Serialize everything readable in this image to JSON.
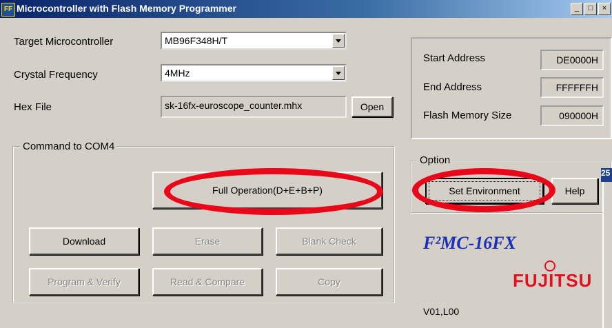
{
  "window": {
    "title": "Microcontroller with Flash Memory Programmer",
    "controls": [
      "_",
      "□",
      "×"
    ]
  },
  "target_mc": {
    "label": "Target Microcontroller",
    "value": "MB96F348H/T"
  },
  "crystal": {
    "label": "Crystal Frequency",
    "value": "4MHz"
  },
  "hexfile": {
    "label": "Hex File",
    "value": "sk-16fx-euroscope_counter.mhx",
    "open_label": "Open"
  },
  "info": {
    "start_label": "Start Address",
    "start_value": "DE0000H",
    "end_label": "End Address",
    "end_value": "FFFFFFH",
    "size_label": "Flash Memory Size",
    "size_value": "090000H"
  },
  "command": {
    "legend": "Command to COM4",
    "full_op": "Full Operation(D+E+B+P)",
    "download": "Download",
    "erase": "Erase",
    "blank": "Blank Check",
    "program": "Program & Verify",
    "read": "Read & Compare",
    "copy": "Copy"
  },
  "option": {
    "legend": "Option",
    "set_env": "Set Environment",
    "help": "Help"
  },
  "brand": {
    "f2mc": "F²MC-16FX",
    "fujitsu": "FUJITSU",
    "version": "V01,L00"
  },
  "side": {
    "badge": "25"
  },
  "colors": {
    "title_gradient_start": "#0a246a",
    "highlight": "#e8081a",
    "f2mc": "#1c2fb8",
    "fujitsu": "#e01020"
  }
}
